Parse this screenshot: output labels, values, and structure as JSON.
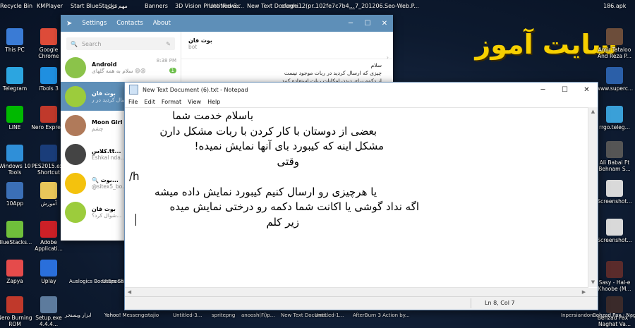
{
  "top_labels": [
    "Recycle Bin",
    "KMPlayer",
    "Start BlueStacks",
    "مهم ترین",
    "Banners",
    "3D Vision Photo Viewer",
    "Untitled-6....",
    "New Text Docume...",
    "ofoghi12(pr...",
    "102fe7c7b4...",
    "__7_201206...",
    "Seo-Web.P...",
    "186.apk"
  ],
  "desktop_icons_left": [
    {
      "label": "This PC",
      "color": "#3a7bd5"
    },
    {
      "label": "Telegram",
      "color": "#2ca5e0"
    },
    {
      "label": "LINE",
      "color": "#00b900"
    },
    {
      "label": "Windows 10 Tools",
      "color": "#2f8fd8"
    },
    {
      "label": "10App",
      "color": "#3b6fb6"
    },
    {
      "label": "BlueStacks...",
      "color": "#6fbf3b"
    },
    {
      "label": "Zapya",
      "color": "#e54b4b"
    },
    {
      "label": "Nero Burning ROM",
      "color": "#c0392b"
    }
  ],
  "desktop_icons_col2": [
    {
      "label": "Google Chrome",
      "color": "#dd4b39"
    },
    {
      "label": "iTools 3",
      "color": "#1f8fe0"
    },
    {
      "label": "Nero Express",
      "color": "#c0392b"
    },
    {
      "label": "PES2015.exe Shortcut",
      "color": "#1a3d7a"
    },
    {
      "label": "آموزش",
      "color": "#e8c65a"
    },
    {
      "label": "Adobe Applicati...",
      "color": "#cc2027"
    },
    {
      "label": "Uplay",
      "color": "#2a6fdb"
    },
    {
      "label": "Setup.exe 4.4.4...",
      "color": "#5d7b9d"
    }
  ],
  "bottom_labels": [
    "Auslogics BoostSpeed",
    "Users Sh... Gabriel",
    "ابزار ویسنجر",
    "Yahoo! Messenger",
    "tajio",
    "Untitled-3...",
    "spritepng",
    "anoosh(Fi)p...",
    "New Text Docume...",
    "Untitled-1...",
    "AfterBurn 3 Action by...",
    "Inpersiandon...",
    "Behzad Pax - Naghat Va..."
  ],
  "right_icons": [
    "Amir Tataloo And Reza P...",
    "www.superc...",
    "rrgo.teleg...",
    "Ali Babai Ft Behnam S...",
    "Screenshot...",
    "Screenshot...",
    "Sasy - Hal-e Khoobe (M...",
    "Behzad Pax - Naghat Va..."
  ],
  "banner_text": "سایت آموز",
  "telegram": {
    "nav": [
      "Settings",
      "Contacts",
      "About"
    ],
    "search_placeholder": "Search",
    "header_title": "بوت فان",
    "header_sub": "bot",
    "message_lines": [
      "سلام",
      "چیزی که ارسال کردید در ربات موجود نیست",
      "از دکمه برای دیدن امکانات ربات استفاده کنید"
    ],
    "chats": [
      {
        "name": "Android",
        "preview": "سلام به همه گلهای 😍😍",
        "time": "8:38 PM",
        "badge": "1",
        "color": "#8bc34a"
      },
      {
        "name": "بوت فان",
        "preview": "ارسال کردید در ر...",
        "time": "",
        "badge": "",
        "color": "#9ccc3c"
      },
      {
        "name": "Moon Girl 🌙",
        "preview": "چشم",
        "time": "",
        "badge": "",
        "color": "#b07a5a"
      },
      {
        "name": "کلاس.tt...",
        "preview": "Eshkal nda...",
        "time": "",
        "badge": "",
        "color": "#444"
      },
      {
        "name": "🔍 بوت...",
        "preview": "@sitex5_bo...",
        "time": "",
        "badge": "",
        "color": "#f4c20d"
      },
      {
        "name": "بوت فان",
        "preview": "شوال کرد؟...",
        "time": "",
        "badge": "",
        "color": "#9ccc3c"
      }
    ]
  },
  "notepad": {
    "title": "New Text Document (6).txt - Notepad",
    "menu": [
      "File",
      "Edit",
      "Format",
      "View",
      "Help"
    ],
    "lines": [
      {
        "text": "باسلام خدمت شما",
        "dir": "rtl"
      },
      {
        "text": "بعضی از دوستان با کار کردن با ربات مشکل دارن",
        "dir": "rtl"
      },
      {
        "text": "مشکل اینه که کیبورد بای آنها نمایش نمیده!",
        "dir": "rtl"
      },
      {
        "text": "وقتی",
        "dir": "rtl"
      },
      {
        "text": "/h",
        "dir": "ltr"
      },
      {
        "text": "یا هرچیزی رو ارسال کنیم کیبورد نمایش داده میشه",
        "dir": "rtl"
      },
      {
        "text": "اگه نداد گوشی یا اکانت شما دکمه رو درختی نمایش میده",
        "dir": "rtl"
      },
      {
        "text": "زیر کلم",
        "dir": "rtl"
      }
    ],
    "status": "Ln 8, Col 7"
  }
}
